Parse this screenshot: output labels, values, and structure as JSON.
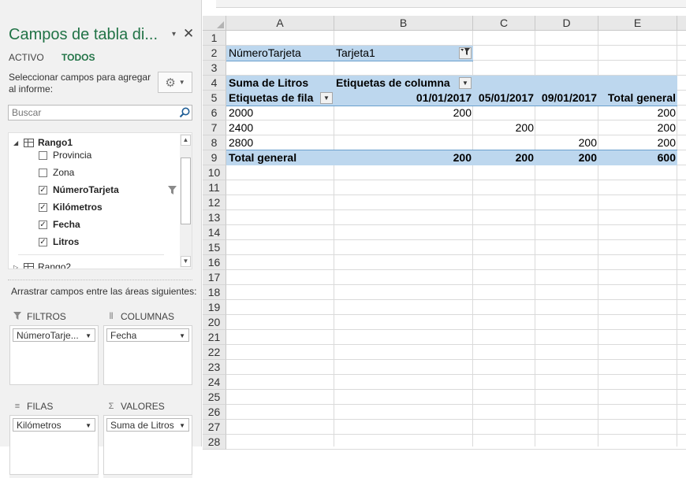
{
  "pane": {
    "title": "Campos de tabla di...",
    "close_glyph": "✕",
    "dropdown_glyph": "▾",
    "tab_active": "ACTIVO",
    "tab_all": "TODOS",
    "choose_text": "Seleccionar campos para agregar al informe:",
    "search_placeholder": "Buscar",
    "tables": [
      {
        "label": "Rango1",
        "expanded": true
      },
      {
        "label": "Rango2",
        "expanded": false
      }
    ],
    "fields": [
      {
        "label": "Provincia",
        "checked": false,
        "bold": false,
        "filtered": false
      },
      {
        "label": "Zona",
        "checked": false,
        "bold": false,
        "filtered": false
      },
      {
        "label": "NúmeroTarjeta",
        "checked": true,
        "bold": true,
        "filtered": true
      },
      {
        "label": "Kilómetros",
        "checked": true,
        "bold": true,
        "filtered": false
      },
      {
        "label": "Fecha",
        "checked": true,
        "bold": true,
        "filtered": false
      },
      {
        "label": "Litros",
        "checked": true,
        "bold": true,
        "filtered": false
      }
    ],
    "drag_text": "Arrastrar campos entre las áreas siguientes:",
    "areas": {
      "filters": {
        "title": "FILTROS",
        "item": "NúmeroTarje..."
      },
      "columns": {
        "title": "COLUMNAS",
        "item": "Fecha"
      },
      "rows": {
        "title": "FILAS",
        "item": "Kilómetros"
      },
      "values": {
        "title": "VALORES",
        "item": "Suma de Litros"
      }
    }
  },
  "sheet": {
    "columns": [
      "A",
      "B",
      "C",
      "D",
      "E"
    ],
    "rows": [
      "1",
      "2",
      "3",
      "4",
      "5",
      "6",
      "7",
      "8",
      "9",
      "10",
      "11",
      "12",
      "13",
      "14",
      "15",
      "16",
      "17",
      "18",
      "19",
      "20",
      "21",
      "22",
      "23",
      "24",
      "25",
      "26",
      "27",
      "28"
    ],
    "filter_field": "NúmeroTarjeta",
    "filter_value": "Tarjeta1",
    "values_header": "Suma de Litros",
    "col_labels_header": "Etiquetas de columna",
    "row_labels_header": "Etiquetas de fila",
    "dates": [
      "01/01/2017",
      "05/01/2017",
      "09/01/2017"
    ],
    "grand_total_label": "Total general",
    "data_rows": [
      {
        "label": "2000",
        "v1": "200",
        "v2": "",
        "v3": "",
        "total": "200"
      },
      {
        "label": "2400",
        "v1": "",
        "v2": "200",
        "v3": "",
        "total": "200"
      },
      {
        "label": "2800",
        "v1": "",
        "v2": "",
        "v3": "200",
        "total": "200"
      }
    ],
    "totals": {
      "v1": "200",
      "v2": "200",
      "v3": "200",
      "total": "600"
    }
  },
  "colors": {
    "accent": "#217346",
    "pivot_band": "#bdd7ee"
  }
}
